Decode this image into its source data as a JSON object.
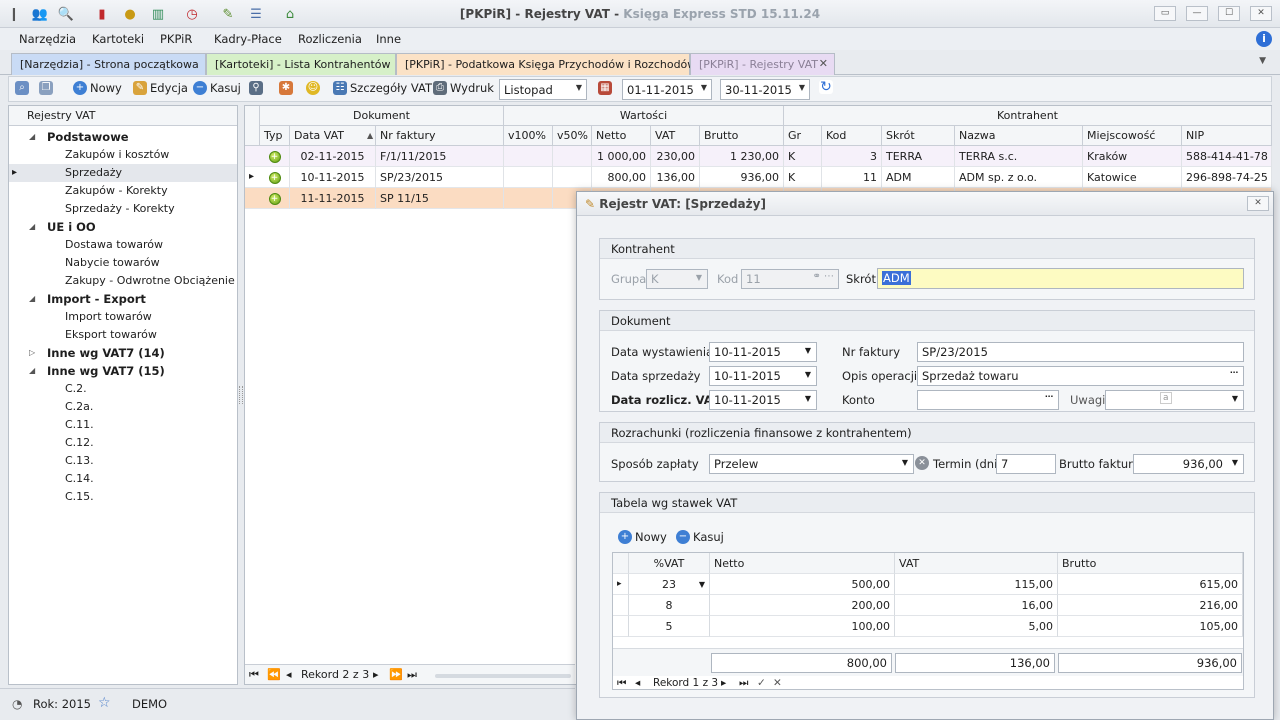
{
  "window": {
    "title_main": "[PKPiR] - Rejestry VAT",
    "title_sub": "Księga Express STD 15.11.24",
    "buttons": {
      "restore": "▭",
      "min": "—",
      "max": "☐",
      "close": "✕"
    }
  },
  "menu": [
    "Narzędzia",
    "Kartoteki",
    "PKPiR",
    "Kadry-Płace",
    "Rozliczenia",
    "Inne"
  ],
  "tabs": [
    {
      "label": "[Narzędzia] - Strona początkowa",
      "color": "#c9dbf5"
    },
    {
      "label": "[Kartoteki] - Lista Kontrahentów",
      "color": "#d6f0c8"
    },
    {
      "label": "[PKPiR] - Podatkowa Księga Przychodów i Rozchodów",
      "color": "#fbe2c6"
    },
    {
      "label": "[PKPiR] - Rejestry VAT",
      "color": "#e8dbf3"
    }
  ],
  "toolbar": {
    "new": "Nowy",
    "edit": "Edycja",
    "delete": "Kasuj",
    "details": "Szczegóły VAT",
    "print": "Wydruk",
    "month": "Listopad",
    "date_from": "01-11-2015",
    "date_to": "30-11-2015"
  },
  "tree": {
    "header": "Rejestry VAT",
    "rows": [
      {
        "label": "Podstawowe",
        "group": true,
        "expanded": true
      },
      {
        "label": "Zakupów i kosztów"
      },
      {
        "label": "Sprzedaży",
        "selected": true
      },
      {
        "label": "Zakupów - Korekty"
      },
      {
        "label": "Sprzedaży - Korekty"
      },
      {
        "label": "UE i OO",
        "group": true,
        "expanded": true
      },
      {
        "label": "Dostawa towarów"
      },
      {
        "label": "Nabycie towarów"
      },
      {
        "label": "Zakupy - Odwrotne Obciążenie"
      },
      {
        "label": "Import - Export",
        "group": true,
        "expanded": true
      },
      {
        "label": "Import towarów"
      },
      {
        "label": "Eksport towarów"
      },
      {
        "label": "Inne wg VAT7 (14)",
        "group": true,
        "expanded": false
      },
      {
        "label": "Inne wg VAT7 (15)",
        "group": true,
        "expanded": true
      },
      {
        "label": "C.2."
      },
      {
        "label": "C.2a."
      },
      {
        "label": "C.11."
      },
      {
        "label": "C.12."
      },
      {
        "label": "C.13."
      },
      {
        "label": "C.14."
      },
      {
        "label": "C.15."
      }
    ]
  },
  "grid": {
    "bands": {
      "doc": "Dokument",
      "values": "Wartości",
      "contractor": "Kontrahent"
    },
    "columns": [
      "Typ",
      "Data VAT",
      "Nr faktury",
      "v100%",
      "v50%",
      "Netto",
      "VAT",
      "Brutto",
      "Gr",
      "Kod",
      "Skrót",
      "Nazwa",
      "Miejscowość",
      "NIP"
    ],
    "rows": [
      {
        "date": "02-11-2015",
        "nr": "F/1/11/2015",
        "netto": "1 000,00",
        "vat": "230,00",
        "brutto": "1 230,00",
        "gr": "K",
        "kod": "3",
        "skrot": "TERRA",
        "nazwa": "TERRA s.c.",
        "miasto": "Kraków",
        "nip": "588-414-41-78"
      },
      {
        "date": "10-11-2015",
        "nr": "SP/23/2015",
        "netto": "800,00",
        "vat": "136,00",
        "brutto": "936,00",
        "gr": "K",
        "kod": "11",
        "skrot": "ADM",
        "nazwa": "ADM sp. z o.o.",
        "miasto": "Katowice",
        "nip": "296-898-74-25"
      },
      {
        "date": "11-11-2015",
        "nr": "SP 11/15",
        "netto": "",
        "vat": "",
        "brutto": "",
        "gr": "",
        "kod": "",
        "skrot": "",
        "nazwa": "",
        "miasto": "",
        "nip": ""
      }
    ],
    "nav": "Rekord 2 z 3"
  },
  "status": {
    "year": "Rok: 2015",
    "mode": "DEMO"
  },
  "dialog": {
    "title": "Rejestr VAT:  [Sprzedaży]",
    "kontrahent": {
      "header": "Kontrahent",
      "grupa_label": "Grupa",
      "grupa": "K",
      "kod_label": "Kod",
      "kod": "11",
      "skrot_label": "Skrót",
      "skrot": "ADM"
    },
    "dokument": {
      "header": "Dokument",
      "data_wyst_label": "Data wystawienia",
      "data_wyst": "10-11-2015",
      "data_sprz_label": "Data sprzedaży",
      "data_sprz": "10-11-2015",
      "data_rozl_label": "Data rozlicz. VAT",
      "data_rozl": "10-11-2015",
      "nr_label": "Nr faktury",
      "nr": "SP/23/2015",
      "opis_label": "Opis operacji",
      "opis": "Sprzedaż towaru",
      "konto_label": "Konto",
      "konto": "",
      "uwagi_label": "Uwagi"
    },
    "rozrachunki": {
      "header": "Rozrachunki (rozliczenia finansowe z kontrahentem)",
      "sposob_label": "Sposób zapłaty",
      "sposob": "Przelew",
      "termin_label": "Termin (dni)",
      "termin": "7",
      "brutto_label": "Brutto faktury",
      "brutto": "936,00"
    },
    "tabela": {
      "header": "Tabela wg stawek VAT",
      "new": "Nowy",
      "delete": "Kasuj",
      "columns": [
        "%VAT",
        "Netto",
        "VAT",
        "Brutto"
      ],
      "rows": [
        {
          "rate": "23",
          "netto": "500,00",
          "vat": "115,00",
          "brutto": "615,00"
        },
        {
          "rate": "8",
          "netto": "200,00",
          "vat": "16,00",
          "brutto": "216,00"
        },
        {
          "rate": "5",
          "netto": "100,00",
          "vat": "5,00",
          "brutto": "105,00"
        }
      ],
      "totals": {
        "netto": "800,00",
        "vat": "136,00",
        "brutto": "936,00"
      },
      "nav": "Rekord 1 z 3"
    }
  }
}
